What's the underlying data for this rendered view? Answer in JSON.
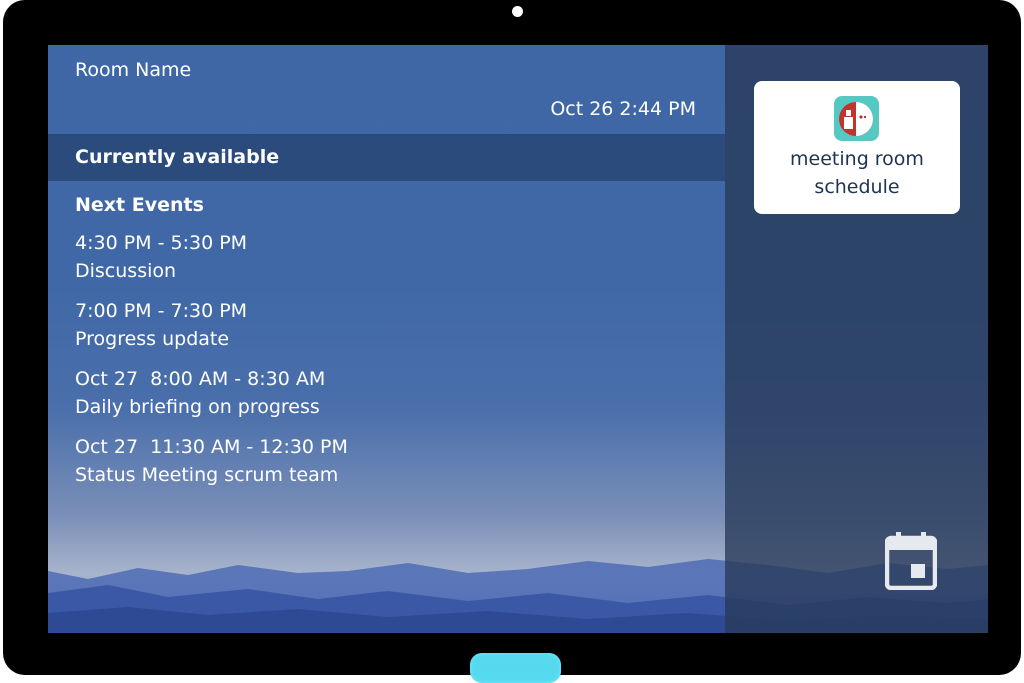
{
  "header": {
    "room_name": "Room Name",
    "datetime": "Oct 26 2:44 PM"
  },
  "status": {
    "text": "Currently available"
  },
  "events": {
    "heading": "Next Events",
    "items": [
      {
        "time": "4:30 PM - 5:30 PM",
        "title": "Discussion"
      },
      {
        "time": "7:00 PM - 7:30 PM",
        "title": "Progress update"
      },
      {
        "time": "Oct 27  8:00 AM - 8:30 AM",
        "title": "Daily briefing on progress"
      },
      {
        "time": "Oct 27  11:30 AM - 12:30 PM",
        "title": "Status Meeting scrum team"
      }
    ]
  },
  "side": {
    "app_label_line1": "meeting room",
    "app_label_line2": "schedule",
    "app_icon": "meeting-room-app-icon",
    "calendar_icon": "calendar-icon"
  },
  "colors": {
    "status_bar": "#2a4b7c",
    "side_panel": "#283a58",
    "app_icon_teal": "#56c8c2",
    "app_icon_red": "#c0342e",
    "home_button": "#55d9ee"
  }
}
